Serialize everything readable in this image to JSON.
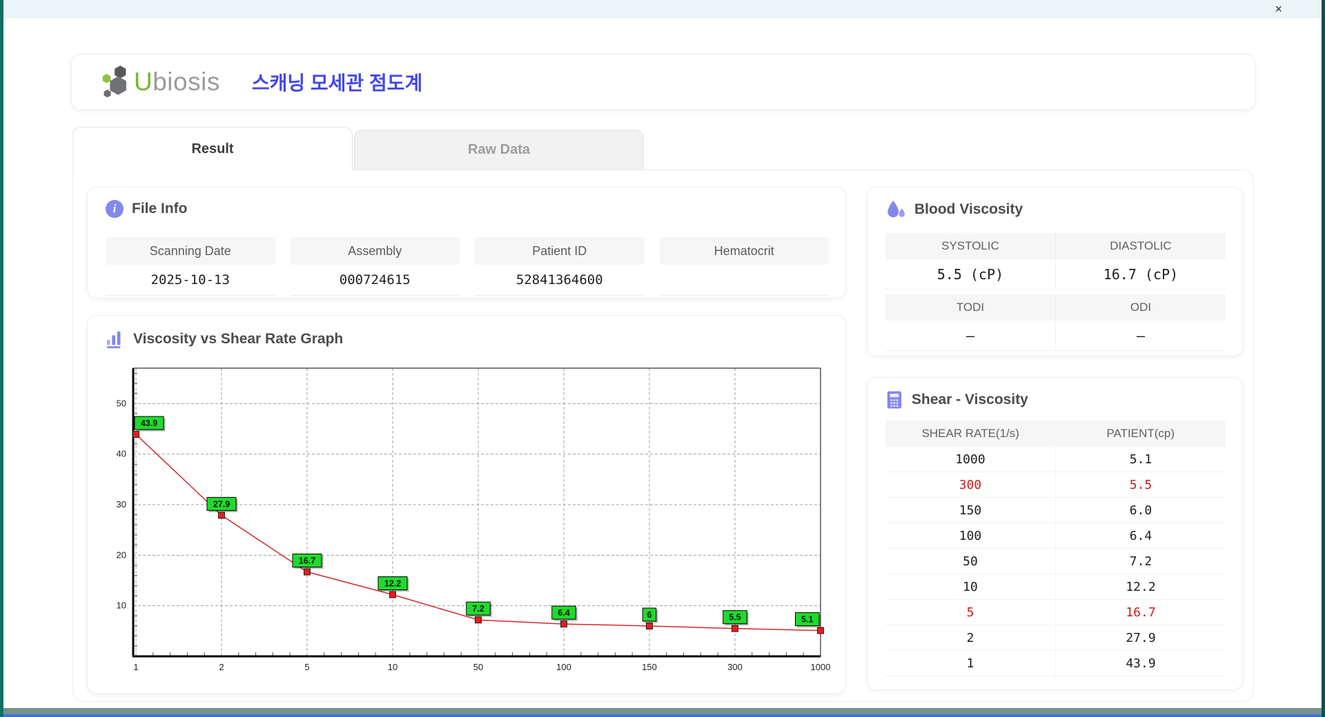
{
  "window": {
    "close_icon": "×"
  },
  "header": {
    "logo_u": "U",
    "logo_rest": "biosis",
    "title_ko": "스캐닝 모세관 점도계"
  },
  "tabs": [
    {
      "label": "Result",
      "active": true
    },
    {
      "label": "Raw Data",
      "active": false
    }
  ],
  "file_info": {
    "title": "File Info",
    "fields": [
      {
        "label": "Scanning Date",
        "value": "2025-10-13"
      },
      {
        "label": "Assembly",
        "value": "000724615"
      },
      {
        "label": "Patient ID",
        "value": "52841364600"
      },
      {
        "label": "Hematocrit",
        "value": ""
      }
    ]
  },
  "blood_viscosity": {
    "title": "Blood Viscosity",
    "groups": [
      {
        "labels": [
          "SYSTOLIC",
          "DIASTOLIC"
        ],
        "values": [
          "5.5 (cP)",
          "16.7 (cP)"
        ]
      },
      {
        "labels": [
          "TODI",
          "ODI"
        ],
        "values": [
          "–",
          "–"
        ]
      }
    ]
  },
  "graph": {
    "title": "Viscosity vs Shear Rate Graph"
  },
  "chart_data": {
    "type": "line",
    "title": "Viscosity vs Shear Rate Graph",
    "categories": [
      "1",
      "2",
      "5",
      "10",
      "50",
      "100",
      "150",
      "300",
      "1000"
    ],
    "values": [
      43.9,
      27.9,
      16.7,
      12.2,
      7.2,
      6.4,
      6.0,
      5.5,
      5.1
    ],
    "point_labels": [
      "43.9",
      "27.9",
      "16.7",
      "12.2",
      "7.2",
      "6.4",
      "6",
      "5.5",
      "5.1"
    ],
    "xlabel": "",
    "ylabel": "",
    "yticks": [
      10,
      20,
      30,
      40,
      50
    ],
    "ylim": [
      0,
      57
    ],
    "x_scale": "ordinal-equal-spacing",
    "grid": "dashed",
    "line_color": "#cf2b2b",
    "marker_color": "#ee1b1b",
    "marker_stroke": "#222222",
    "label_bg": "#22d92e",
    "label_border": "#000000",
    "grid_color": "#9f9f9f",
    "axis_color": "#000000"
  },
  "shear_viscosity": {
    "title": "Shear - Viscosity",
    "columns": [
      "SHEAR RATE(1/s)",
      "PATIENT(cp)"
    ],
    "rows": [
      {
        "shear": "1000",
        "patient": "5.1",
        "highlight": false
      },
      {
        "shear": "300",
        "patient": "5.5",
        "highlight": true
      },
      {
        "shear": "150",
        "patient": "6.0",
        "highlight": false
      },
      {
        "shear": "100",
        "patient": "6.4",
        "highlight": false
      },
      {
        "shear": "50",
        "patient": "7.2",
        "highlight": false
      },
      {
        "shear": "10",
        "patient": "12.2",
        "highlight": false
      },
      {
        "shear": "5",
        "patient": "16.7",
        "highlight": true
      },
      {
        "shear": "2",
        "patient": "27.9",
        "highlight": false
      },
      {
        "shear": "1",
        "patient": "43.9",
        "highlight": false
      }
    ]
  },
  "colors": {
    "accent_purple": "#8289ea",
    "title_blue": "#4347e9",
    "logo_green": "#79b62c",
    "highlight_red": "#ce1c1c",
    "chrome_teal": "#156e63",
    "chrome_blue": "#4a70d0"
  }
}
